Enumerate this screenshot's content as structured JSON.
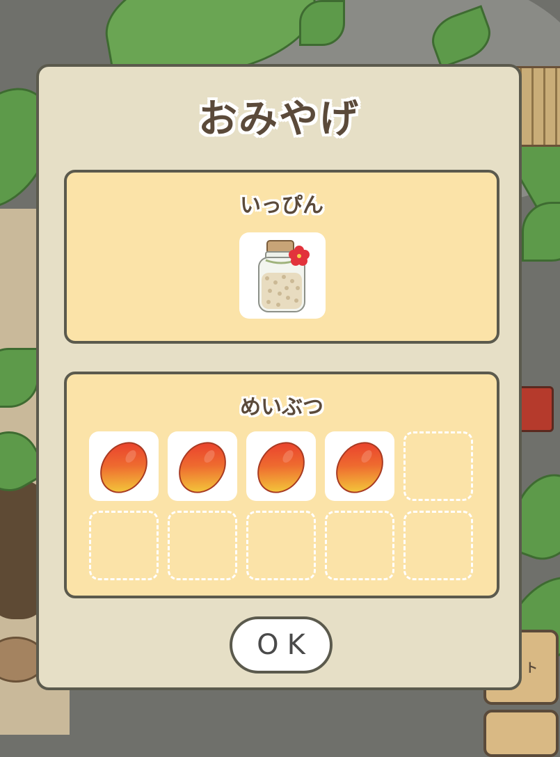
{
  "dialog": {
    "title": "おみやげ",
    "specialty": {
      "title": "いっぴん",
      "item": {
        "icon": "glass-jar-with-hibiscus-icon",
        "filled": true
      }
    },
    "local_goods": {
      "title": "めいぶつ",
      "slots": [
        {
          "icon": "mango-icon",
          "filled": true
        },
        {
          "icon": "mango-icon",
          "filled": true
        },
        {
          "icon": "mango-icon",
          "filled": true
        },
        {
          "icon": "mango-icon",
          "filled": true
        },
        {
          "icon": "",
          "filled": false
        },
        {
          "icon": "",
          "filled": false
        },
        {
          "icon": "",
          "filled": false
        },
        {
          "icon": "",
          "filled": false
        },
        {
          "icon": "",
          "filled": false
        },
        {
          "icon": "",
          "filled": false
        }
      ]
    },
    "ok_label": "OK"
  },
  "side_buttons": [
    {
      "label": "ト"
    },
    {
      "label": ""
    }
  ],
  "colors": {
    "dialog_bg": "#e6dfc6",
    "panel_bg": "#fbe3a8",
    "border": "#5b5a4d",
    "title_text": "#5b4a3a"
  }
}
